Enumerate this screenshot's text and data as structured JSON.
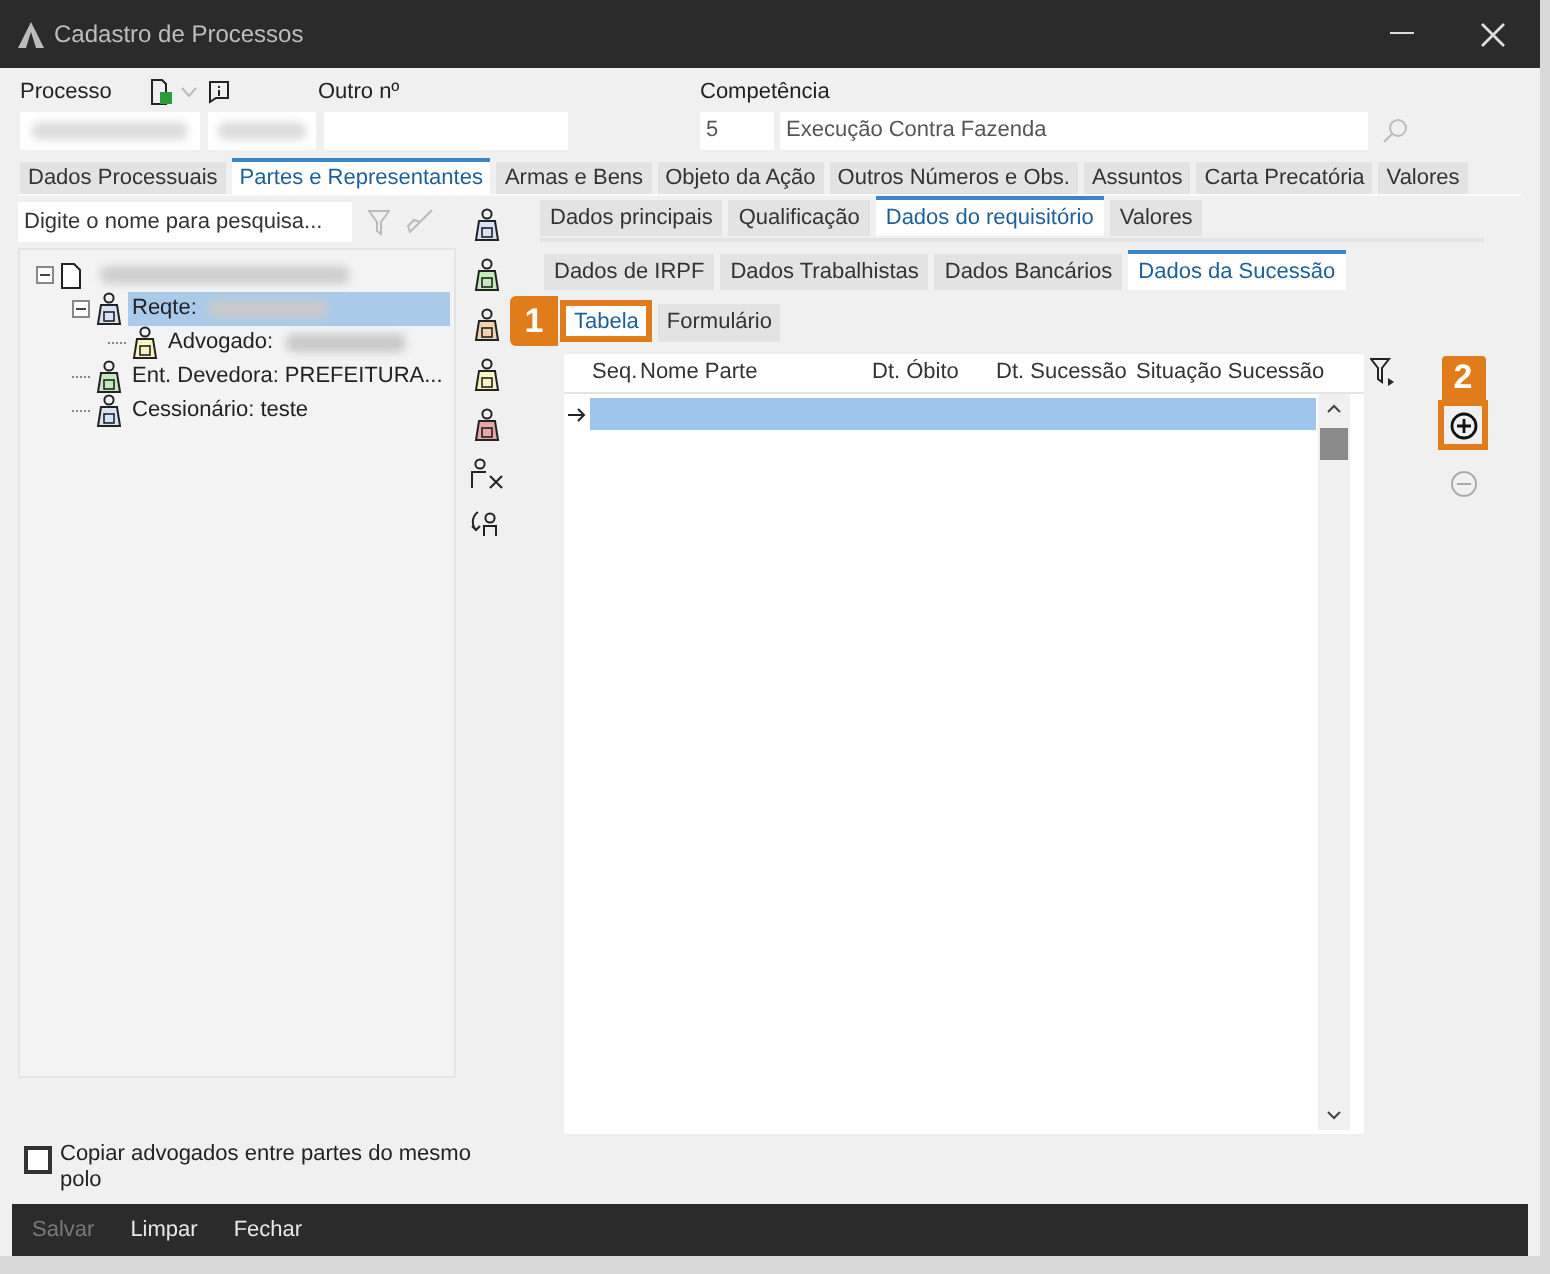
{
  "window": {
    "title": "Cadastro de Processos"
  },
  "header": {
    "processo_label": "Processo",
    "outro_label": "Outro nº",
    "competencia_label": "Competência",
    "competencia_code": "5",
    "competencia_value": "Execução Contra Fazenda"
  },
  "tabs": [
    {
      "label": "Dados Processuais",
      "selected": false
    },
    {
      "label": "Partes e Representantes",
      "selected": true
    },
    {
      "label": "Armas e Bens",
      "selected": false
    },
    {
      "label": "Objeto da Ação",
      "selected": false
    },
    {
      "label": "Outros Números e Obs.",
      "selected": false
    },
    {
      "label": "Assuntos",
      "selected": false
    },
    {
      "label": "Carta Precatória",
      "selected": false
    },
    {
      "label": "Valores",
      "selected": false
    }
  ],
  "search": {
    "placeholder": "Digite o nome para pesquisa..."
  },
  "tree": [
    {
      "expanded": true,
      "kind": "document",
      "children": [
        {
          "label": "Reqte:",
          "kind": "person",
          "color": "#d6e4f5",
          "selected": true,
          "expanded": true,
          "children": [
            {
              "label": "Advogado:",
              "kind": "person",
              "color": "#fbf3c4",
              "selected": false
            }
          ]
        },
        {
          "label": "Ent. Devedora: PREFEITURA...",
          "kind": "person",
          "color": "#c6e8bd",
          "selected": false
        },
        {
          "label": "Cessionário: teste",
          "kind": "person",
          "color": "#d6e4f5",
          "selected": false
        }
      ]
    }
  ],
  "side_tools": [
    {
      "kind": "person",
      "color": "#d6e4f5"
    },
    {
      "kind": "person",
      "color": "#c6e8bd"
    },
    {
      "kind": "person",
      "color": "#f1d3b0"
    },
    {
      "kind": "person",
      "color": "#fbf3c4"
    },
    {
      "kind": "person",
      "color": "#e8a6a6"
    },
    {
      "kind": "remove"
    },
    {
      "kind": "swap"
    }
  ],
  "subtabs": [
    {
      "label": "Dados principais",
      "selected": false
    },
    {
      "label": "Qualificação",
      "selected": false
    },
    {
      "label": "Dados do requisitório",
      "selected": true
    },
    {
      "label": "Valores",
      "selected": false
    }
  ],
  "subtabs_2": [
    {
      "label": "Dados de IRPF",
      "selected": false
    },
    {
      "label": "Dados Trabalhistas",
      "selected": false
    },
    {
      "label": "Dados Bancários",
      "selected": false
    },
    {
      "label": "Dados da Sucessão",
      "selected": true
    }
  ],
  "view_tabs": [
    {
      "label": "Tabela",
      "selected": true
    },
    {
      "label": "Formulário",
      "selected": false
    }
  ],
  "table": {
    "columns": [
      "Seq.",
      "Nome Parte",
      "Dt. Óbito",
      "Dt. Sucessão",
      "Situação Sucessão"
    ],
    "rows": [
      {
        "selected": true
      }
    ]
  },
  "annotations": [
    "1",
    "2"
  ],
  "copy_checkbox": {
    "label": "Copiar advogados entre partes do mesmo polo",
    "checked": false
  },
  "footer": [
    {
      "label": "Salvar",
      "disabled": true
    },
    {
      "label": "Limpar",
      "disabled": false
    },
    {
      "label": "Fechar",
      "disabled": false
    }
  ]
}
